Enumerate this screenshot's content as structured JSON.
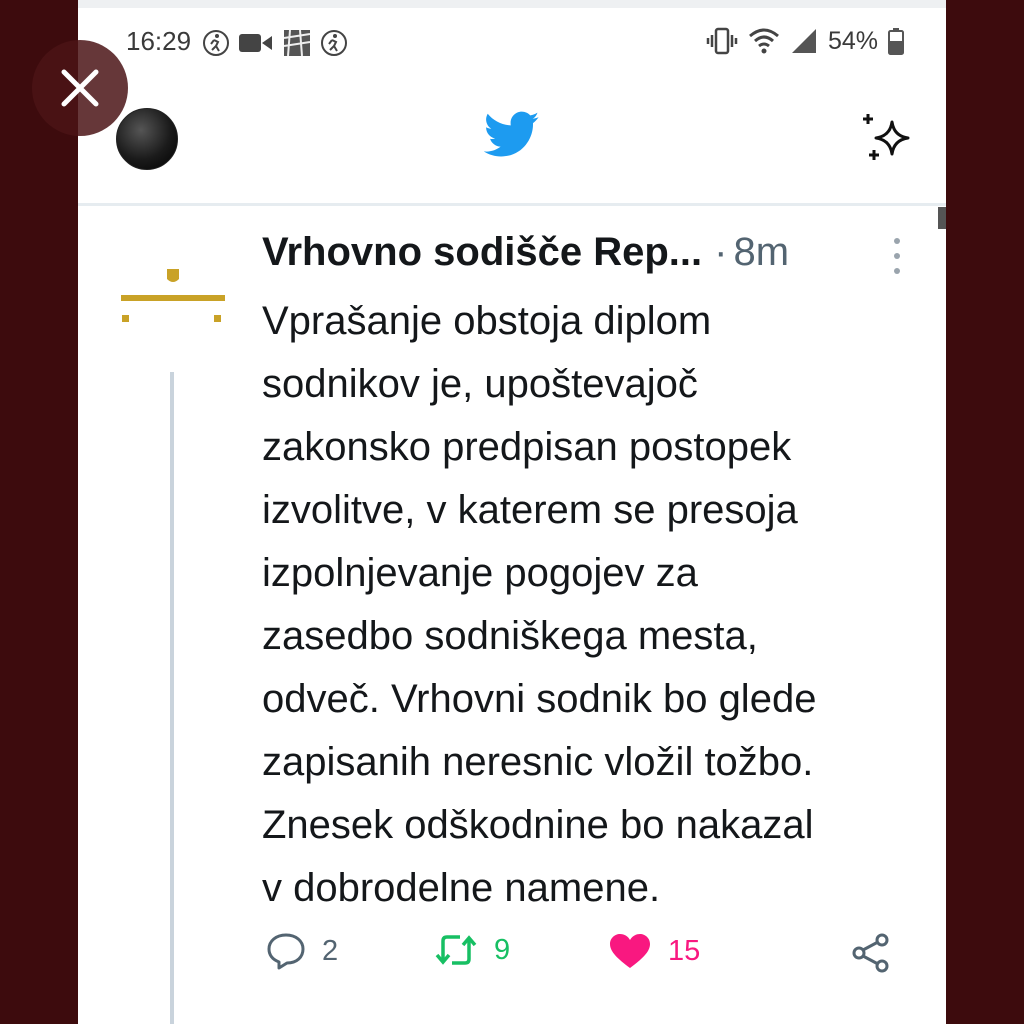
{
  "status_bar": {
    "time": "16:29",
    "battery": "54%",
    "left_icons": [
      "activity-icon",
      "video-icon",
      "image-icon",
      "activity-icon"
    ],
    "right_icons": [
      "vibrate-icon",
      "wifi-icon",
      "signal-icon",
      "battery-icon"
    ]
  },
  "overlay": {
    "close_icon": "close-icon"
  },
  "header": {
    "logo_icon": "twitter-bird-icon",
    "sparkle_icon": "sparkle-icon",
    "colors": {
      "twitter_blue": "#1d9bf0"
    }
  },
  "tweet": {
    "author": "Vrhovno sodišče Rep...",
    "separator": "·",
    "time_ago": "8m",
    "lines": [
      "Vprašanje obstoja diplom",
      "sodnikov je, upoštevajoč",
      "zakonsko predpisan postopek",
      "izvolitve, v katerem se presoja",
      "izpolnjevanje pogojev za",
      "zasedbo sodniškega mesta,",
      "odveč. Vrhovni sodnik bo glede",
      "zapisanih neresnic vložil tožbo.",
      "Znesek odškodnine bo nakazal",
      "v dobrodelne namene."
    ],
    "actions": {
      "replies": "2",
      "retweets": "9",
      "likes": "15"
    },
    "colors": {
      "retweet": "#17bf63",
      "like": "#f91880",
      "gold": "#c9a227"
    }
  }
}
